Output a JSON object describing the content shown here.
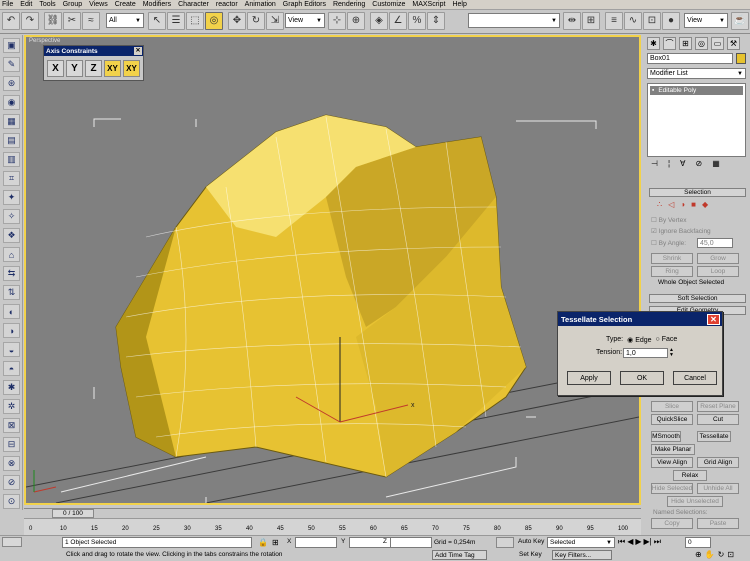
{
  "menu": [
    "File",
    "Edit",
    "Tools",
    "Group",
    "Views",
    "Create",
    "Modifiers",
    "Character",
    "reactor",
    "Animation",
    "Graph Editors",
    "Rendering",
    "Customize",
    "MAXScript",
    "Help"
  ],
  "toolbar": {
    "selection_filter": "All",
    "ref_coord": "View",
    "named_selection": "",
    "render_view": "View",
    "icons": [
      "undo-icon",
      "redo-icon",
      "link-icon",
      "unlink-icon",
      "bind-icon",
      "filter-dropdown",
      "select-icon",
      "select-by-name-icon",
      "region-select-icon",
      "window-crossing-icon",
      "move-icon",
      "rotate-icon",
      "scale-icon",
      "coord-dropdown",
      "pivot-icon",
      "snap-toggle-icon",
      "angle-snap-icon",
      "percent-snap-icon",
      "spinner-snap-icon",
      "named-sets-dropdown",
      "mirror-icon",
      "align-icon",
      "layer-icon",
      "curve-editor-icon",
      "schematic-icon",
      "material-editor-icon",
      "render-scene-icon",
      "quick-render-icon",
      "render-type-dropdown"
    ]
  },
  "viewport": {
    "label": "Perspective"
  },
  "axis_constraints": {
    "title": "Axis Constraints",
    "buttons": [
      "X",
      "Y",
      "Z",
      "XY",
      "XY"
    ]
  },
  "command_panel": {
    "object_name": "Box01",
    "color_swatch": "#e6c22e",
    "modifier_list": "Modifier List",
    "stack_item": "Editable Poly",
    "selection_rollout": "Selection",
    "by_vertex": "By Vertex",
    "ignore_backfacing": "Ignore Backfacing",
    "by_angle": "By Angle:",
    "by_angle_value": "45,0",
    "shrink": "Shrink",
    "grow": "Grow",
    "ring": "Ring",
    "loop": "Loop",
    "whole_object": "Whole Object Selected",
    "soft_selection": "Soft Selection",
    "edit_geometry": "Edit Geometry",
    "slice": "Slice",
    "reset_plane": "Reset Plane",
    "quickslice": "QuickSlice",
    "cut": "Cut",
    "msmooth": "MSmooth",
    "tessellate": "Tessellate",
    "make_planar": "Make Planar",
    "view_align": "View Align",
    "grid_align": "Grid Align",
    "relax": "Relax",
    "hide_selected": "Hide Selected",
    "unhide_all": "Unhide All",
    "hide_unselected": "Hide Unselected",
    "named_selections": "Named Selections:",
    "copy": "Copy",
    "paste": "Paste"
  },
  "tessellate_dialog": {
    "title": "Tessellate Selection",
    "type_label": "Type:",
    "edge": "Edge",
    "face": "Face",
    "tension_label": "Tension:",
    "tension_value": "1,0",
    "apply": "Apply",
    "ok": "OK",
    "cancel": "Cancel"
  },
  "timeline": {
    "frame": "0 / 100",
    "ticks": [
      "0",
      "10",
      "15",
      "20",
      "25",
      "30",
      "35",
      "40",
      "45",
      "50",
      "55",
      "60",
      "65",
      "70",
      "75",
      "80",
      "85",
      "90",
      "95",
      "100"
    ]
  },
  "status": {
    "selection": "1 Object Selected",
    "prompt": "Click and drag to rotate the view.  Clicking in the tabs constrains the rotation",
    "x_label": "X",
    "y_label": "Y",
    "z_label": "Z",
    "grid": "Grid = 0,254m",
    "add_time_tag": "Add Time Tag",
    "auto_key": "Auto Key",
    "set_key": "Set Key",
    "key_mode": "Selected",
    "key_filters": "Key Filters...",
    "frame_value": "0"
  }
}
